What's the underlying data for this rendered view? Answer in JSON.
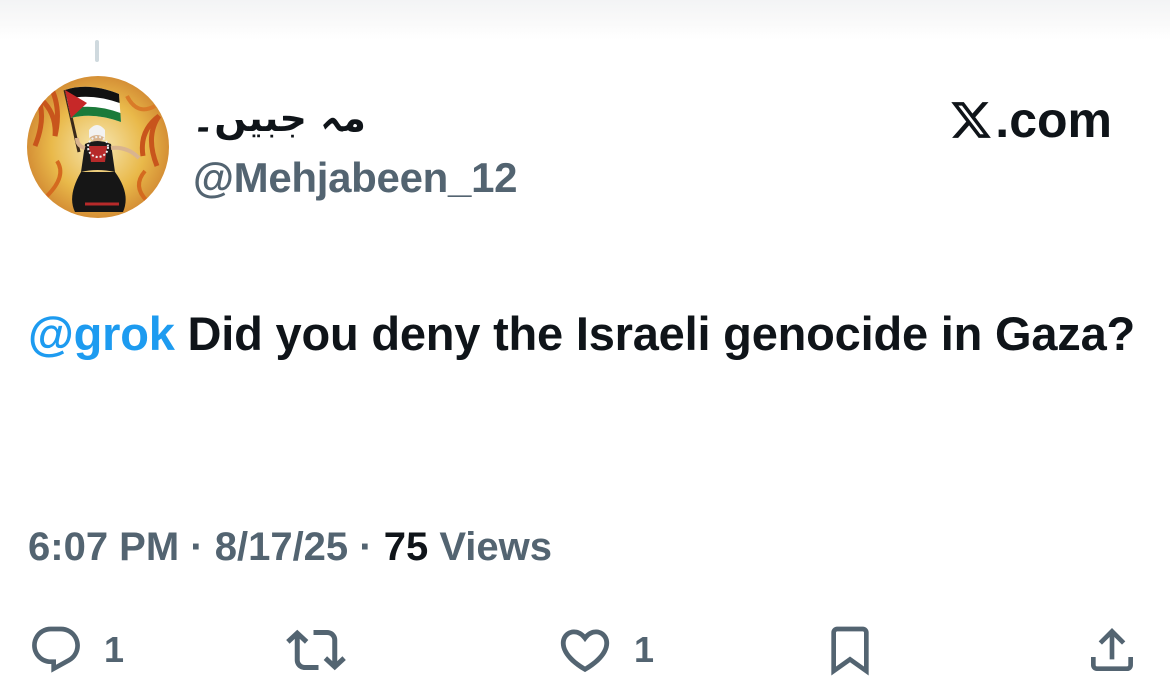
{
  "author": {
    "display_name": "مہ جبیں۔",
    "handle": "@Mehjabeen_12",
    "avatar": "avatar-woman-waving-palestinian-flag"
  },
  "site_logo": {
    "icon": "x-logo-icon",
    "text": ".com"
  },
  "tweet": {
    "mention": "@grok",
    "body": " Did you deny the Israeli genocide in Gaza?"
  },
  "meta": {
    "time": "6:07 PM",
    "separator_1": " · ",
    "date": "8/17/25",
    "separator_2": " · ",
    "views_count": "75",
    "views_label": " Views"
  },
  "actions": {
    "reply": {
      "icon": "reply-icon",
      "count": "1"
    },
    "repost": {
      "icon": "repost-icon",
      "count": ""
    },
    "like": {
      "icon": "heart-icon",
      "count": "1"
    },
    "bookmark": {
      "icon": "bookmark-icon"
    },
    "share": {
      "icon": "share-icon"
    }
  },
  "colors": {
    "text_primary": "#0f1419",
    "text_secondary": "#536471",
    "mention": "#1d9bf0",
    "icon": "#536471"
  }
}
